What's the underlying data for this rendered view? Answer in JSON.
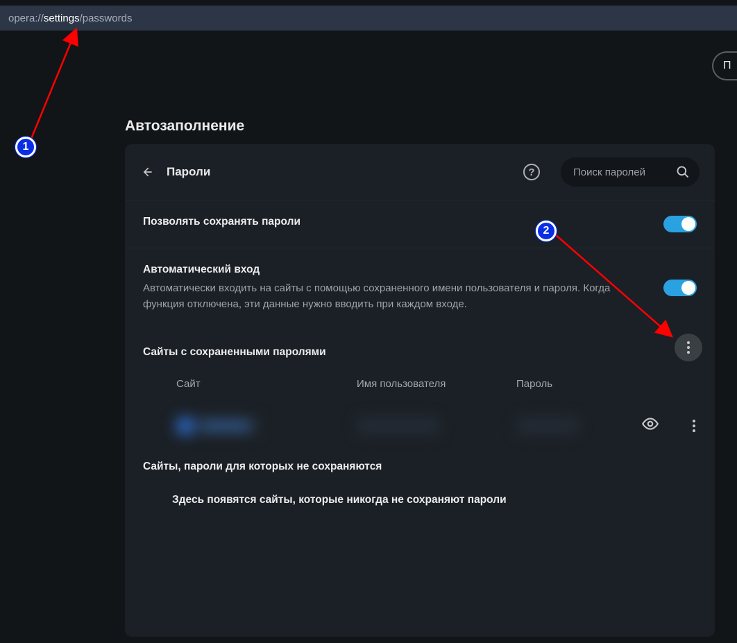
{
  "url": {
    "pre": "opera://",
    "mid": "settings",
    "post": "/passwords"
  },
  "header_button_fragment": "П",
  "section_title": "Автозаполнение",
  "panel": {
    "title": "Пароли",
    "search_placeholder": "Поиск паролей",
    "help_glyph": "?"
  },
  "row_save": {
    "label": "Позволять сохранять пароли"
  },
  "row_autologin": {
    "label": "Автоматический вход",
    "desc": "Автоматически входить на сайты с помощью сохраненного имени пользователя и пароля. Когда функция отключена, эти данные нужно вводить при каждом входе."
  },
  "saved": {
    "subtitle": "Сайты с сохраненными паролями",
    "cols": {
      "site": "Сайт",
      "user": "Имя пользователя",
      "pass": "Пароль"
    }
  },
  "never": {
    "subtitle": "Сайты, пароли для которых не сохраняются",
    "empty": "Здесь появятся сайты, которые никогда не сохраняют пароли"
  },
  "annotations": {
    "a1": "1",
    "a2": "2"
  }
}
